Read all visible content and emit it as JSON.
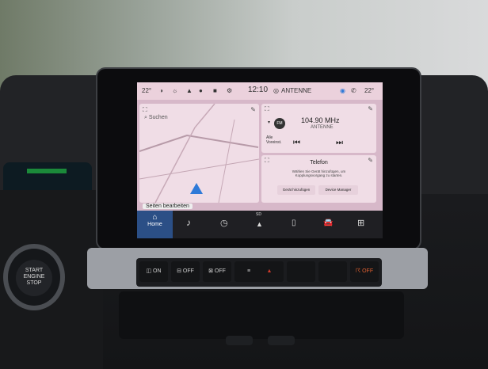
{
  "status_bar": {
    "temp_left": "22°",
    "time": "12:10",
    "station": "ANTENNE",
    "temp_right": "22°"
  },
  "map": {
    "search_label": "Suchen",
    "edit_label": "Seiten bearbeiten"
  },
  "radio": {
    "band": "FM",
    "frequency": "104.90 MHz",
    "station_name": "ANTENNE",
    "presets_label": "Alle Voreinst."
  },
  "phone": {
    "title": "Telefon",
    "message": "Wählen Sie Gerät hinzufügen, um Kopplungsvorgang zu starten.",
    "add_device": "Gerät hinzufügen",
    "device_manager": "Device Manager"
  },
  "dock": {
    "home_label": "Home",
    "sd_label": "SD"
  },
  "physical_buttons": {
    "on_label": "ON",
    "off_label_1": "OFF",
    "off_label_2": "OFF",
    "off_label_3": "OFF"
  },
  "start_button": {
    "line1": "START",
    "line2": "ENGINE",
    "line3": "STOP"
  },
  "colors": {
    "screen_bg": "#d7b8c9",
    "home_tile": "#2b4f86",
    "nav_arrow": "#2f7ad8",
    "hazard_red": "#d23b2b"
  }
}
